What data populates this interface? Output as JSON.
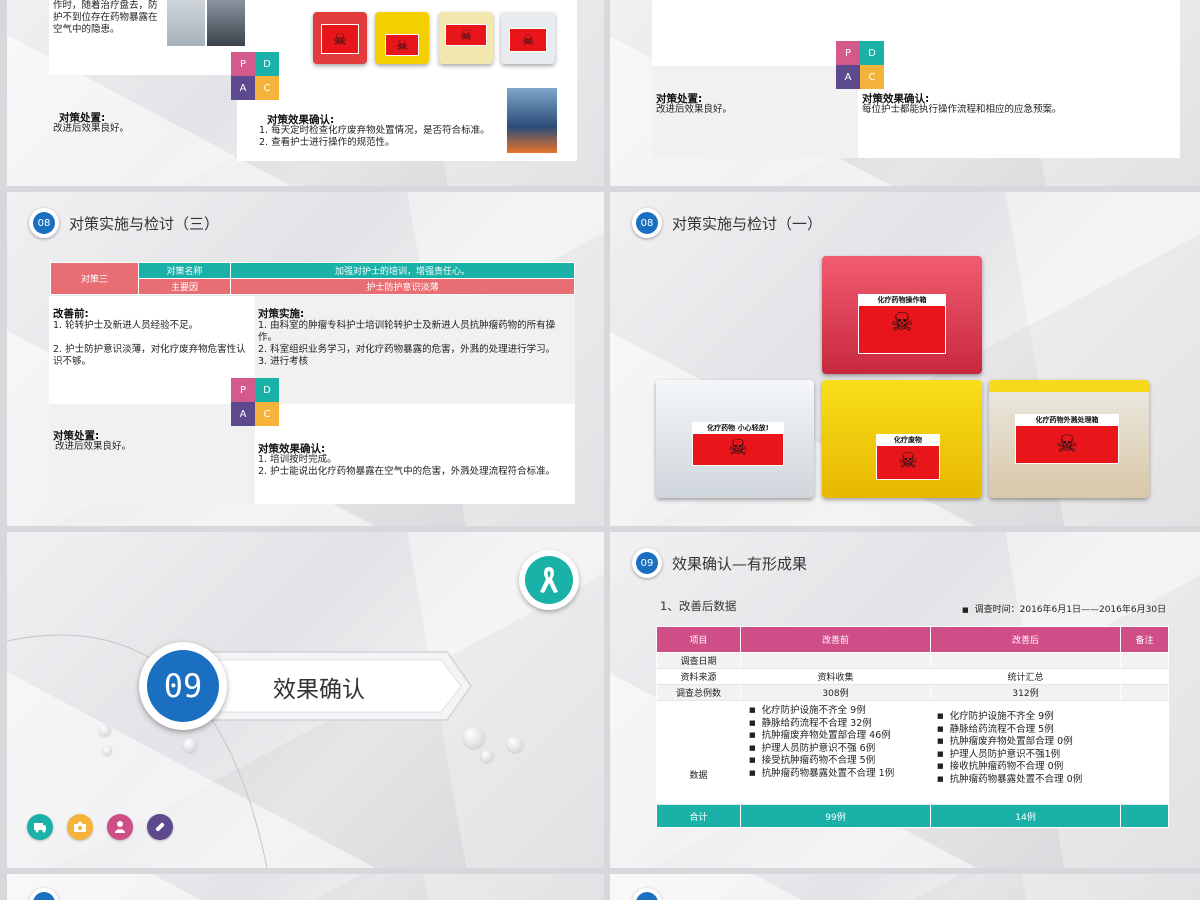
{
  "top_left": {
    "text_cut_lines": [
      "作时，随着治疗盘去，防",
      "护不到位存在药物暴露在",
      "空气中的隐患。"
    ],
    "handling_label": "对策处置:",
    "handling_text": "改进后效果良好。",
    "effect_label": "对策效果确认:",
    "effect_items": [
      "1.   每天定时检查化疗废弃物处置情况，是否符合标准。",
      "2.   查看护士进行操作的规范性。"
    ]
  },
  "top_right": {
    "handling_label": "对策处置:",
    "handling_text": "改进后效果良好。",
    "effect_label": "对策效果确认:",
    "effect_text": "每位护士都能执行操作流程和相应的应急预案。"
  },
  "pdca": {
    "p": "P",
    "d": "D",
    "a": "A",
    "c": "C"
  },
  "slide_mid_left": {
    "badge": "08",
    "title": "对策实施与检讨（三）",
    "table": {
      "left_cell": "对策三",
      "row1_label": "对策名称",
      "row1_value": "加强对护士的培训，增强责任心。",
      "row2_label": "主要因",
      "row2_value": "护士防护意识淡薄"
    },
    "before_label": "改善前:",
    "before_items": [
      "1. 轮转护士及新进人员经验不足。",
      "2. 护士防护意识淡薄，对化疗废弃物危害性认识不够。"
    ],
    "impl_label": "对策实施:",
    "impl_items": [
      "1. 由科室的肿瘤专科护士培训轮转护士及新进人员抗肿瘤药物的所有操作。",
      "2. 科室组织业务学习，对化疗药物暴露的危害，外溅的处理进行学习。",
      "3. 进行考核"
    ],
    "handling_label": "对策处置:",
    "handling_text": "改进后效果良好。",
    "effect_label": "对策效果确认:",
    "effect_items": [
      "1.   培训按时完成。",
      "2.   护士能说出化疗药物暴露在空气中的危害，外溅处理流程符合标准。"
    ]
  },
  "slide_mid_right": {
    "badge": "08",
    "title": "对策实施与检讨（一）",
    "box_labels": [
      "化疗药物操作箱",
      "化疗药物  小心轻放!",
      "化疗废物",
      "化疗药物外溅处理箱"
    ]
  },
  "slide_bottom_left": {
    "number": "09",
    "title": "效果确认",
    "ribbon_icon": "awareness-ribbon-icon",
    "footer_icons": [
      "ambulance-icon",
      "camera-icon",
      "nurse-icon",
      "pill-icon"
    ],
    "colors": {
      "teal": "#1ab1a8",
      "orange": "#f6b33b",
      "pink": "#cf4e87",
      "purple": "#5d4a8e",
      "blue": "#1b6fc0"
    }
  },
  "slide_bottom_right": {
    "badge": "09",
    "title": "效果确认—有形成果",
    "subtitle": "1、改善后数据",
    "survey_time": "调查时间：2016年6月1日——2016年6月30日",
    "table": {
      "headers": [
        "项目",
        "改善前",
        "改善后",
        "备注"
      ],
      "rows": [
        {
          "label": "调查日期",
          "before": "",
          "after": "",
          "note": ""
        },
        {
          "label": "资料来源",
          "before": "资料收集",
          "after": "统计汇总",
          "note": ""
        },
        {
          "label": "调查总例数",
          "before": "308例",
          "after": "312例",
          "note": ""
        }
      ],
      "data_label": "数据",
      "before_items": [
        "化疗防护设施不齐全 9例",
        "静脉给药流程不合理 32例",
        "抗肿瘤废弃物处置部合理 46例",
        "护理人员防护意识不强 6例",
        "接受抗肿瘤药物不合理 5例",
        "抗肿瘤药物暴露处置不合理 1例"
      ],
      "after_items": [
        "化疗防护设施不齐全 9例",
        "静脉给药流程不合理 5例",
        "抗肿瘤废弃物处置部合理 0例",
        "护理人员防护意识不强1例",
        "接收抗肿瘤药物不合理 0例",
        "抗肿瘤药物暴露处置不合理 0例"
      ],
      "total_label": "合计",
      "total_before": "99例",
      "total_after": "14例"
    }
  }
}
